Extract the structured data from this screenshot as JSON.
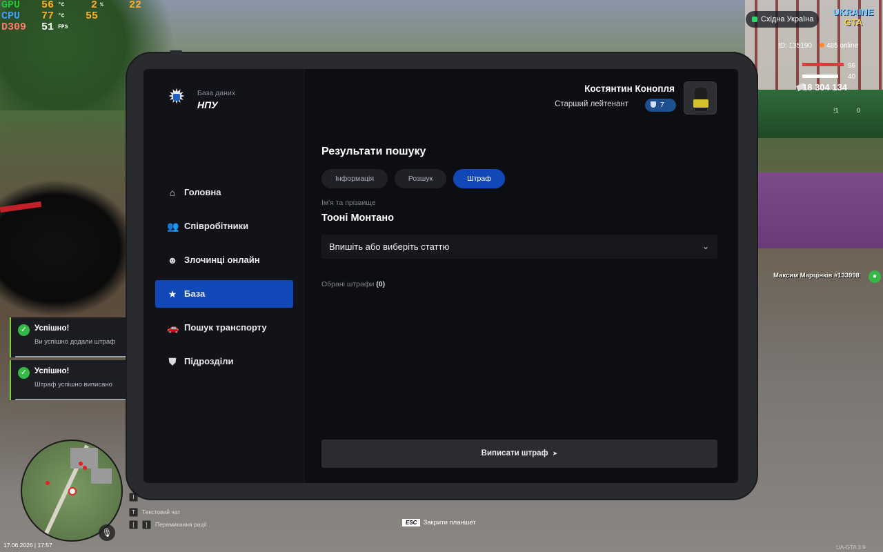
{
  "hud": {
    "gpu_label": "GPU",
    "gpu_temp": "56",
    "gpu_temp_unit": "°C",
    "gpu_load": "2",
    "gpu_load_unit": "%",
    "gpu_extra": "22",
    "cpu_label": "CPU",
    "cpu_temp": "77",
    "cpu_temp_unit": "°C",
    "cpu_load": "55",
    "d3d_label": "D309",
    "fps": "51",
    "fps_unit": "FPS",
    "region": "Східна Україна",
    "logo_line1": "UKRAINE",
    "logo_line2": "GTA",
    "player_id": "ID: 135190",
    "online": "485 online",
    "health": "96",
    "armor": "40",
    "money": "18 304 134",
    "ammo_clip": "1",
    "ammo_total": "0",
    "nick_tag": "Максим Марцінків #133998",
    "date_time": "17.06.2026 | 17:57",
    "key_text_chat_cap": "T",
    "key_text_chat": "Текстовий чат",
    "key_radio_cap1": "[",
    "key_radio_cap2": "]",
    "key_radio": "Перемикання раціï",
    "key_blank_cap": "I",
    "esc_cap": "ESC",
    "esc_text": "Закрити планшет",
    "version": "UA-GTA 3.9",
    "mic_icon": "microphone-icon",
    "accent_green": "#36b847"
  },
  "toasts": [
    {
      "title": "Успішно!",
      "message": "Ви успішно додали штраф"
    },
    {
      "title": "Успішно!",
      "message": "Штраф успішно виписано"
    }
  ],
  "tablet": {
    "brand_sub": "База даних",
    "brand_name": "НПУ",
    "nav": [
      {
        "label": "Головна",
        "icon": "home-icon"
      },
      {
        "label": "Співробітники",
        "icon": "users-icon"
      },
      {
        "label": "Злочинці онлайн",
        "icon": "criminal-icon"
      },
      {
        "label": "База",
        "icon": "star-icon",
        "active": true
      },
      {
        "label": "Пошук транспорту",
        "icon": "car-icon"
      },
      {
        "label": "Підрозділи",
        "icon": "shield-icon"
      }
    ],
    "user": {
      "name": "Костянтин Конопля",
      "rank": "Старший лейтенант",
      "rank_level": "7"
    },
    "section_title": "Результати пошуку",
    "tabs": [
      {
        "label": "Інформація"
      },
      {
        "label": "Розшук"
      },
      {
        "label": "Штраф",
        "active": true
      }
    ],
    "name_label": "Ім'я та прізвище",
    "name_value": "Тооні Монтано",
    "article_select_placeholder": "Впишіть або виберіть статтю",
    "chosen_label": "Обрані штрафи",
    "chosen_count": "(0)",
    "action_button": "Виписати штраф",
    "accent_blue": "#1048b8"
  }
}
